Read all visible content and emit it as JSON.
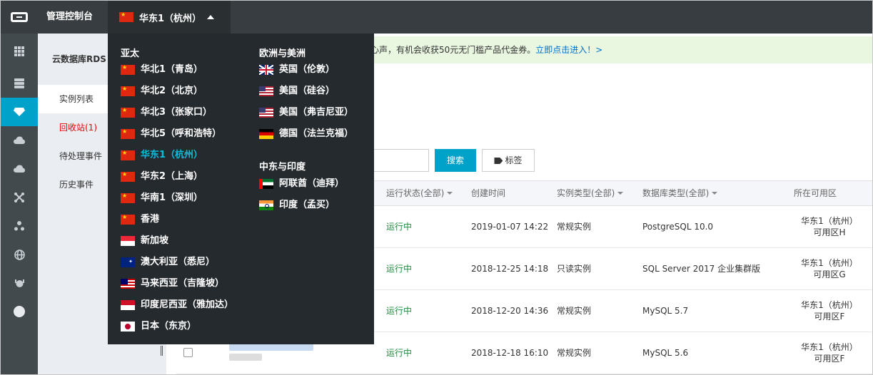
{
  "topbar": {
    "console_title": "管理控制台",
    "current_region": "华东1（杭州）"
  },
  "subnav": {
    "title": "云数据库RDS",
    "items": [
      {
        "label": "实例列表"
      },
      {
        "label": "回收站(1)"
      },
      {
        "label": "待处理事件"
      },
      {
        "label": "历史事件"
      }
    ]
  },
  "notice": {
    "text": "心声，有机会收获50元无门槛产品代金券。",
    "link": "立即点击进入！>"
  },
  "toolbar": {
    "search_label": "搜索",
    "tag_label": "标签"
  },
  "table": {
    "columns": [
      "运行状态(全部)",
      "创建时间",
      "实例类型(全部)",
      "数据库类型(全部)",
      "所在可用区"
    ],
    "rows": [
      {
        "status": "运行中",
        "created": "2019-01-07 14:22",
        "type": "常规实例",
        "db": "PostgreSQL 10.0",
        "zone_line1": "华东1（杭州）",
        "zone_line2": "可用区H"
      },
      {
        "status": "运行中",
        "created": "2018-12-25 14:18",
        "type": "只读实例",
        "db": "SQL Server 2017 企业集群版",
        "zone_line1": "华东1（杭州）",
        "zone_line2": "可用区G"
      },
      {
        "status": "运行中",
        "created": "2018-12-20 14:36",
        "type": "常规实例",
        "db": "MySQL 5.7",
        "zone_line1": "华东1（杭州）",
        "zone_line2": "可用区F"
      },
      {
        "status": "运行中",
        "created": "2018-12-18 16:10",
        "type": "常规实例",
        "db": "MySQL 5.6",
        "zone_line1": "华东1（杭州）",
        "zone_line2": "可用区F"
      }
    ]
  },
  "regions": {
    "asia_title": "亚太",
    "asia": [
      {
        "label": "华北1（青岛）",
        "flag": "cn"
      },
      {
        "label": "华北2（北京）",
        "flag": "cn"
      },
      {
        "label": "华北3（张家口）",
        "flag": "cn"
      },
      {
        "label": "华北5（呼和浩特）",
        "flag": "cn"
      },
      {
        "label": "华东1（杭州）",
        "flag": "cn"
      },
      {
        "label": "华东2（上海）",
        "flag": "cn"
      },
      {
        "label": "华南1（深圳）",
        "flag": "cn"
      },
      {
        "label": "香港",
        "flag": "cn"
      },
      {
        "label": "新加坡",
        "flag": "sg"
      },
      {
        "label": "澳大利亚（悉尼）",
        "flag": "au"
      },
      {
        "label": "马来西亚（吉隆坡）",
        "flag": "my"
      },
      {
        "label": "印度尼西亚（雅加达）",
        "flag": "id"
      },
      {
        "label": "日本（东京）",
        "flag": "jp"
      }
    ],
    "euam_title": "欧洲与美洲",
    "euam": [
      {
        "label": "英国（伦敦）",
        "flag": "gb"
      },
      {
        "label": "美国（硅谷）",
        "flag": "us"
      },
      {
        "label": "美国（弗吉尼亚）",
        "flag": "us"
      },
      {
        "label": "德国（法兰克福）",
        "flag": "de"
      }
    ],
    "mein_title": "中东与印度",
    "mein": [
      {
        "label": "阿联酋（迪拜）",
        "flag": "ae"
      },
      {
        "label": "印度（孟买）",
        "flag": "in"
      }
    ]
  }
}
